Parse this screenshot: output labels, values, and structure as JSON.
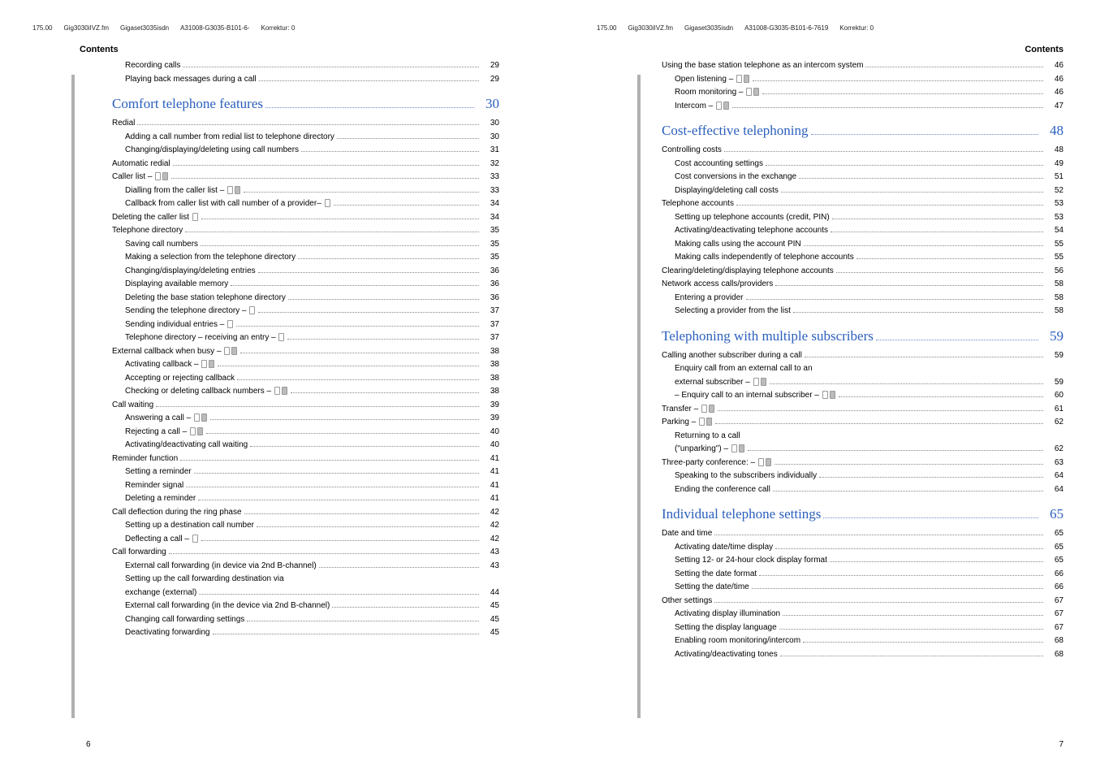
{
  "header_left": [
    "175.00",
    "Gig3030iIVZ.fm",
    "Gigaset3035isdn",
    "A31008-G3035-B101-6-",
    "Korrektur: 0"
  ],
  "header_right": [
    "175.00",
    "Gig3030iIVZ.fm",
    "Gigaset3035isdn",
    "A31008-G3035-B101-6-7619",
    "Korrektur: 0"
  ],
  "section_label": "Contents",
  "page_num_left": "6",
  "page_num_right": "7",
  "left_toc": [
    {
      "t": "Recording calls",
      "p": "29",
      "i": 1
    },
    {
      "t": "Playing back messages during a call",
      "p": "29",
      "i": 1
    },
    {
      "t": "Comfort telephone features",
      "p": "30",
      "chapter": true
    },
    {
      "t": "Redial",
      "p": "30",
      "i": 0
    },
    {
      "t": "Adding a call number from redial list to telephone directory",
      "p": "30",
      "i": 1
    },
    {
      "t": "Changing/displaying/deleting using call numbers",
      "p": "31",
      "i": 1
    },
    {
      "t": "Automatic redial",
      "p": "32",
      "i": 0
    },
    {
      "t": "Caller list – ",
      "p": "33",
      "i": 0,
      "icons": 2
    },
    {
      "t": "Dialling from the caller list – ",
      "p": "33",
      "i": 1,
      "icons": 2
    },
    {
      "t": "Callback from caller list with call number of a provider– ",
      "p": "34",
      "i": 1,
      "icons": 1
    },
    {
      "t": "Deleting the caller list ",
      "p": "34",
      "i": 0,
      "icons": 1
    },
    {
      "t": "Telephone directory",
      "p": "35",
      "i": 0
    },
    {
      "t": "Saving call numbers",
      "p": "35",
      "i": 1
    },
    {
      "t": "Making a selection from the telephone directory",
      "p": "35",
      "i": 1
    },
    {
      "t": "Changing/displaying/deleting entries",
      "p": "36",
      "i": 1
    },
    {
      "t": "Displaying available memory",
      "p": "36",
      "i": 1
    },
    {
      "t": "Deleting the base station telephone directory",
      "p": "36",
      "i": 1
    },
    {
      "t": "Sending the telephone directory – ",
      "p": "37",
      "i": 1,
      "icons": 1
    },
    {
      "t": "Sending individual entries – ",
      "p": "37",
      "i": 1,
      "icons": 1
    },
    {
      "t": "Telephone directory – receiving an entry – ",
      "p": "37",
      "i": 1,
      "icons": 1
    },
    {
      "t": "External callback when busy – ",
      "p": "38",
      "i": 0,
      "icons": 2
    },
    {
      "t": "Activating callback – ",
      "p": "38",
      "i": 1,
      "icons": 2
    },
    {
      "t": "Accepting or rejecting callback",
      "p": "38",
      "i": 1
    },
    {
      "t": "Checking or deleting callback numbers – ",
      "p": "38",
      "i": 1,
      "icons": 2
    },
    {
      "t": "Call waiting",
      "p": "39",
      "i": 0
    },
    {
      "t": "Answering a call – ",
      "p": "39",
      "i": 1,
      "icons": 2
    },
    {
      "t": "Rejecting a call – ",
      "p": "40",
      "i": 1,
      "icons": 2
    },
    {
      "t": "Activating/deactivating call waiting",
      "p": "40",
      "i": 1
    },
    {
      "t": "Reminder function",
      "p": "41",
      "i": 0
    },
    {
      "t": "Setting a reminder",
      "p": "41",
      "i": 1
    },
    {
      "t": "Reminder signal",
      "p": "41",
      "i": 1
    },
    {
      "t": "Deleting a reminder",
      "p": "41",
      "i": 1
    },
    {
      "t": "Call deflection during the ring phase",
      "p": "42",
      "i": 0
    },
    {
      "t": "Setting up a destination call number",
      "p": "42",
      "i": 1
    },
    {
      "t": "Deflecting a call – ",
      "p": "42",
      "i": 1,
      "icons": 1
    },
    {
      "t": "Call forwarding",
      "p": "43",
      "i": 0
    },
    {
      "t": "External call forwarding (in device via 2nd B-channel)",
      "p": "43",
      "i": 1
    },
    {
      "t": "Setting up the call forwarding destination via",
      "i": 1,
      "nowrap": true
    },
    {
      "t": "exchange (external)",
      "p": "44",
      "i": 1
    },
    {
      "t": "External call forwarding (in the device via 2nd B-channel)",
      "p": "45",
      "i": 1
    },
    {
      "t": "Changing call forwarding settings",
      "p": "45",
      "i": 1
    },
    {
      "t": "Deactivating forwarding",
      "p": "45",
      "i": 1
    }
  ],
  "right_toc": [
    {
      "t": "Using the base station telephone as an intercom system",
      "p": "46",
      "i": 0
    },
    {
      "t": "Open listening – ",
      "p": "46",
      "i": 1,
      "icons": 2
    },
    {
      "t": "Room monitoring – ",
      "p": "46",
      "i": 1,
      "icons": 2
    },
    {
      "t": "Intercom – ",
      "p": "47",
      "i": 1,
      "icons": 2
    },
    {
      "t": "Cost-effective telephoning",
      "p": "48",
      "chapter": true
    },
    {
      "t": "Controlling costs",
      "p": "48",
      "i": 0
    },
    {
      "t": "Cost accounting settings",
      "p": "49",
      "i": 1
    },
    {
      "t": "Cost conversions in the exchange",
      "p": "51",
      "i": 1
    },
    {
      "t": "Displaying/deleting call costs",
      "p": "52",
      "i": 1
    },
    {
      "t": "Telephone accounts",
      "p": "53",
      "i": 0
    },
    {
      "t": "Setting up telephone accounts (credit, PIN)",
      "p": "53",
      "i": 1
    },
    {
      "t": "Activating/deactivating telephone accounts",
      "p": "54",
      "i": 1
    },
    {
      "t": "Making calls using the account PIN",
      "p": "55",
      "i": 1
    },
    {
      "t": "Making calls independently of telephone accounts",
      "p": "55",
      "i": 1
    },
    {
      "t": "Clearing/deleting/displaying telephone accounts",
      "p": "56",
      "i": 0
    },
    {
      "t": "Network access calls/providers",
      "p": "58",
      "i": 0
    },
    {
      "t": "Entering a provider",
      "p": "58",
      "i": 1
    },
    {
      "t": "Selecting a provider from the list",
      "p": "58",
      "i": 1
    },
    {
      "t": "Telephoning with multiple subscribers",
      "p": "59",
      "chapter": true
    },
    {
      "t": "Calling another subscriber during a call",
      "p": "59",
      "i": 0
    },
    {
      "t": "Enquiry call from an external call to an",
      "i": 1,
      "nowrap": true
    },
    {
      "t": "external subscriber – ",
      "p": "59",
      "i": 1,
      "icons": 2
    },
    {
      "t": "– Enquiry call to an internal subscriber – ",
      "p": "60",
      "i": 1,
      "icons": 2
    },
    {
      "t": "Transfer  – ",
      "p": "61",
      "i": 0,
      "icons": 2
    },
    {
      "t": "Parking – ",
      "p": "62",
      "i": 0,
      "icons": 2
    },
    {
      "t": "Returning to a call",
      "i": 1,
      "nowrap": true
    },
    {
      "t": "(\"unparking\") – ",
      "p": "62",
      "i": 1,
      "icons": 2
    },
    {
      "t": "Three-party conference: – ",
      "p": "63",
      "i": 0,
      "icons": 2
    },
    {
      "t": "Speaking to the subscribers individually",
      "p": "64",
      "i": 1
    },
    {
      "t": "Ending the conference call",
      "p": "64",
      "i": 1
    },
    {
      "t": "Individual telephone settings",
      "p": "65",
      "chapter": true
    },
    {
      "t": "Date and time",
      "p": "65",
      "i": 0
    },
    {
      "t": "Activating date/time display",
      "p": "65",
      "i": 1
    },
    {
      "t": "Setting 12- or 24-hour clock display format",
      "p": "65",
      "i": 1
    },
    {
      "t": "Setting the date format",
      "p": "66",
      "i": 1
    },
    {
      "t": "Setting the date/time",
      "p": "66",
      "i": 1
    },
    {
      "t": "Other settings",
      "p": "67",
      "i": 0
    },
    {
      "t": "Activating display illumination",
      "p": "67",
      "i": 1
    },
    {
      "t": "Setting the display language",
      "p": "67",
      "i": 1
    },
    {
      "t": "Enabling room monitoring/intercom",
      "p": "68",
      "i": 1
    },
    {
      "t": "Activating/deactivating tones",
      "p": "68",
      "i": 1
    }
  ]
}
